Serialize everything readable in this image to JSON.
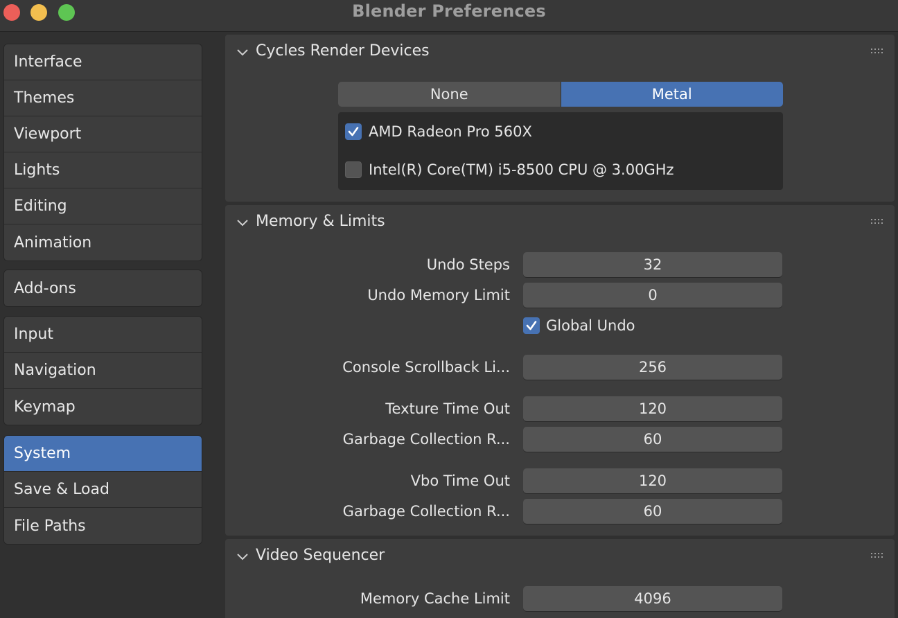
{
  "window": {
    "title": "Blender Preferences"
  },
  "sidebar": {
    "groups": [
      [
        "Interface",
        "Themes",
        "Viewport",
        "Lights",
        "Editing",
        "Animation"
      ],
      [
        "Add-ons"
      ],
      [
        "Input",
        "Navigation",
        "Keymap"
      ],
      [
        "System",
        "Save & Load",
        "File Paths"
      ]
    ],
    "active": "System"
  },
  "cycles": {
    "title": "Cycles Render Devices",
    "backends": [
      "None",
      "Metal"
    ],
    "selected_backend": "Metal",
    "devices": [
      {
        "label": "AMD Radeon Pro 560X",
        "checked": true
      },
      {
        "label": "Intel(R) Core(TM) i5-8500 CPU @ 3.00GHz",
        "checked": false
      }
    ]
  },
  "memory": {
    "title": "Memory & Limits",
    "undo_steps_label": "Undo Steps",
    "undo_steps": "32",
    "undo_memory_label": "Undo Memory Limit",
    "undo_memory": "0",
    "global_undo_label": "Global Undo",
    "global_undo": true,
    "console_label": "Console Scrollback Li...",
    "console": "256",
    "texture_timeout_label": "Texture Time Out",
    "texture_timeout": "120",
    "texture_gc_label": "Garbage Collection R...",
    "texture_gc": "60",
    "vbo_timeout_label": "Vbo Time Out",
    "vbo_timeout": "120",
    "vbo_gc_label": "Garbage Collection R...",
    "vbo_gc": "60"
  },
  "sequencer": {
    "title": "Video Sequencer",
    "cache_label": "Memory Cache Limit",
    "cache": "4096"
  },
  "colors": {
    "accent": "#4772b3",
    "panel": "#3d3d3d",
    "field": "#545454"
  }
}
